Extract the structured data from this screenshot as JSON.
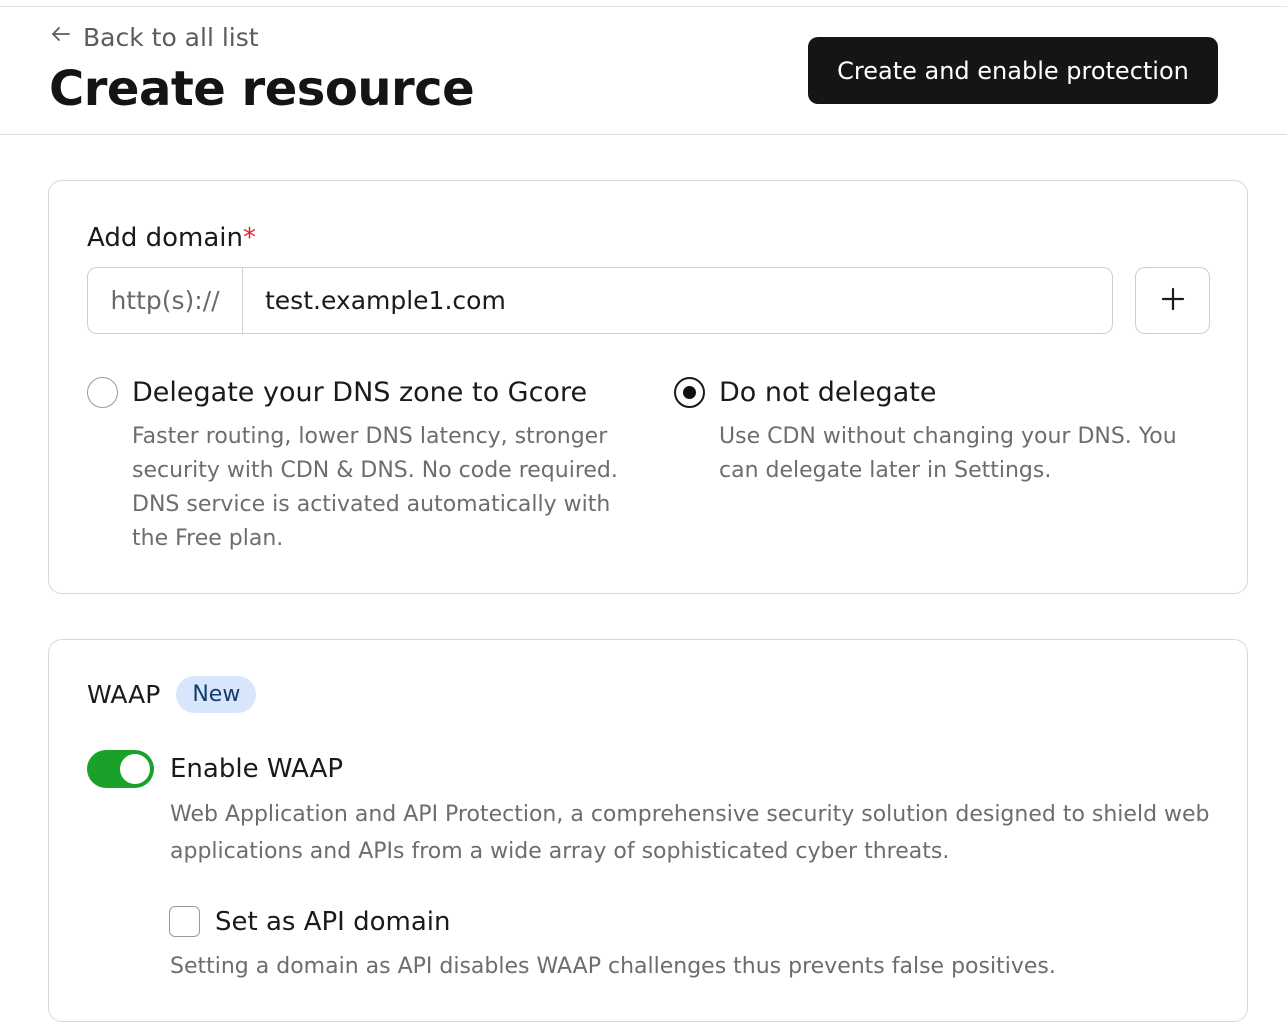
{
  "header": {
    "back_label": "Back to all list",
    "title": "Create resource",
    "primary_button": "Create and enable protection"
  },
  "domain_section": {
    "label": "Add domain",
    "required_mark": "*",
    "prefix": "http(s)://",
    "domain_value": "test.example1.com",
    "add_icon": "plus-icon",
    "options": [
      {
        "title": "Delegate your DNS zone to Gcore",
        "description": "Faster routing, lower DNS latency, stronger security with CDN & DNS. No code required. DNS service is activated automatically with the Free plan.",
        "selected": false
      },
      {
        "title": "Do not delegate",
        "description": "Use CDN without changing your DNS. You can delegate later in Settings.",
        "selected": true
      }
    ]
  },
  "waap_section": {
    "title": "WAAP",
    "badge": "New",
    "toggle_label": "Enable WAAP",
    "toggle_on": true,
    "description": "Web Application and API Protection, a comprehensive security solution designed to shield web applications and APIs from a wide array of sophisticated cyber threats.",
    "api_checkbox_label": "Set as API domain",
    "api_checkbox_checked": false,
    "api_description": "Setting a domain as API disables WAAP challenges thus prevents false positives."
  },
  "colors": {
    "primary_button_bg": "#151515",
    "toggle_on": "#1aa12a",
    "required": "#d8262d",
    "badge_bg": "#d7e6fb"
  }
}
